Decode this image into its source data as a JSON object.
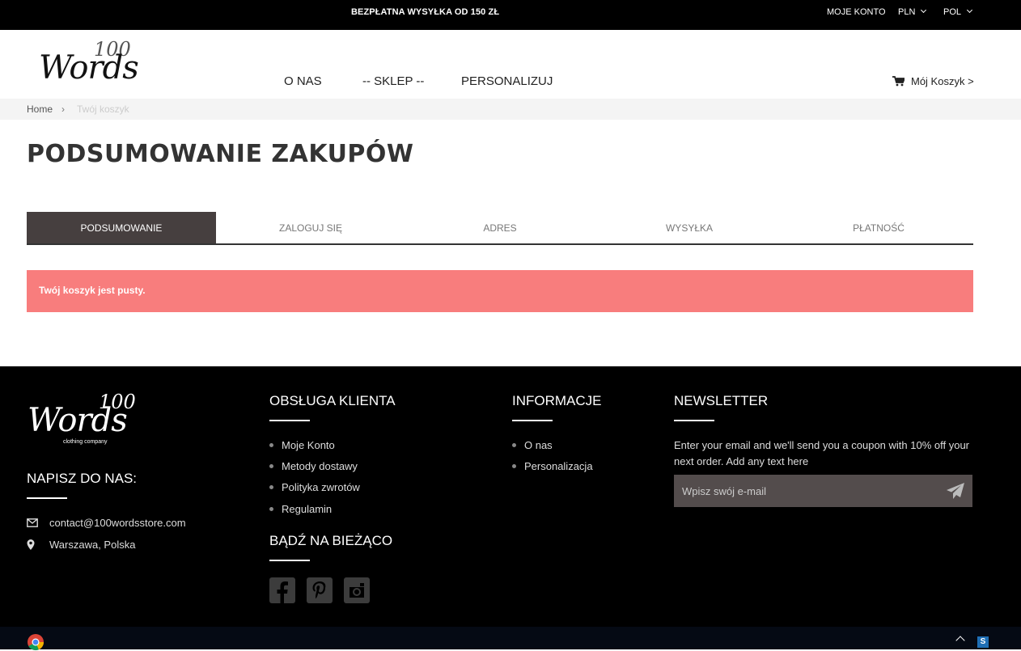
{
  "topbar": {
    "promo": "BEZPŁATNA WYSYŁKA OD 150 ZŁ",
    "account": "MOJE KONTO",
    "currency": "PLN",
    "language": "POL"
  },
  "header": {
    "logo_number": "100",
    "logo_word": "Words",
    "nav": [
      "O NAS",
      "-- SKLEP --",
      "PERSONALIZUJ"
    ],
    "cart_label": "Mój Koszyk >"
  },
  "breadcrumb": {
    "home": "Home",
    "separator": "›",
    "current": "Twój koszyk"
  },
  "page_title": "PODSUMOWANIE ZAKUPÓW",
  "steps": [
    "PODSUMOWANIE",
    "ZALOGUJ SIĘ",
    "ADRES",
    "WYSYŁKA",
    "PŁATNOŚĆ"
  ],
  "active_step": "PODSUMOWANIE",
  "alert": "Twój koszyk jest pusty.",
  "footer": {
    "logo_number": "100",
    "logo_word": "Words",
    "logo_tagline": "clothing company",
    "write_heading": "NAPISZ DO NAS:",
    "email": "contact@100wordsstore.com",
    "location": "Warszawa, Polska",
    "service_heading": "OBSŁUGA KLIENTA",
    "service_links": [
      "Moje Konto",
      "Metody dostawy",
      "Polityka zwrotów",
      "Regulamin"
    ],
    "social_heading": "BĄDŹ NA BIEŻĄCO",
    "social_icons": [
      "facebook-icon",
      "pinterest-icon",
      "instagram-icon"
    ],
    "info_heading": "INFORMACJE",
    "info_links": [
      "O nas",
      "Personalizacja"
    ],
    "newsletter_heading": "NEWSLETTER",
    "newsletter_text": "Enter your email and we'll send you a coupon with 10% off your next order. Add any text here",
    "newsletter_placeholder": "Wpisz swój e-mail"
  },
  "colors": {
    "alert_bg": "#f87d7d",
    "active_step_bg": "#463f3f",
    "newsletter_box": "#534c4c"
  }
}
